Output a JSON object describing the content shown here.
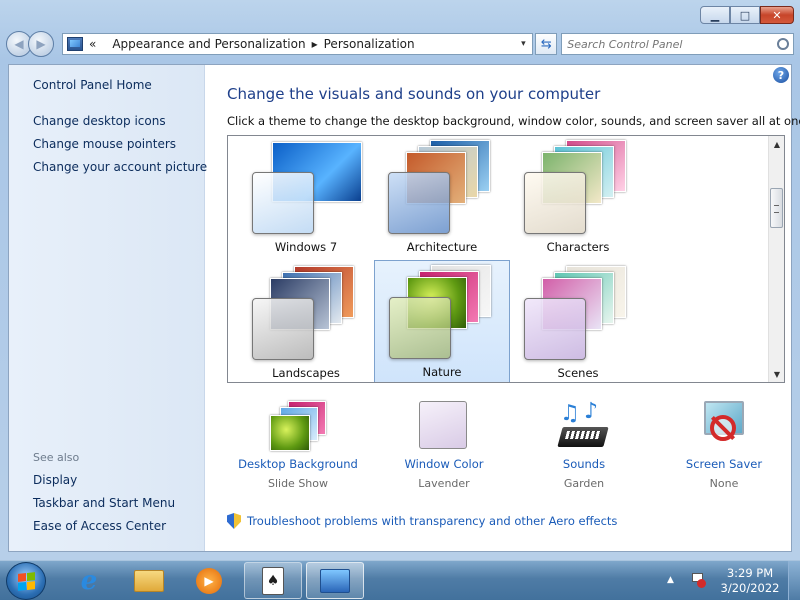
{
  "window": {
    "minimize_label": "▁",
    "maximize_label": "□",
    "close_label": "✕"
  },
  "address": {
    "overflow": "«",
    "sep": "▸",
    "crumbs": [
      "Appearance and Personalization",
      "Personalization"
    ],
    "dropdown": "▾",
    "refresh": "⇆"
  },
  "search": {
    "placeholder": "Search Control Panel"
  },
  "sidebar": {
    "home": "Control Panel Home",
    "links": [
      "Change desktop icons",
      "Change mouse pointers",
      "Change your account picture"
    ],
    "see_also": "See also",
    "see_also_links": [
      "Display",
      "Taskbar and Start Menu",
      "Ease of Access Center"
    ]
  },
  "main": {
    "help": "?",
    "title": "Change the visuals and sounds on your computer",
    "subtitle": "Click a theme to change the desktop background, window color, sounds, and screen saver all at once.",
    "themes": [
      {
        "label": "Windows 7",
        "selected": false
      },
      {
        "label": "Architecture",
        "selected": false
      },
      {
        "label": "Characters",
        "selected": false
      },
      {
        "label": "Landscapes",
        "selected": false
      },
      {
        "label": "Nature",
        "selected": true
      },
      {
        "label": "Scenes",
        "selected": false
      }
    ],
    "settings": [
      {
        "link": "Desktop Background",
        "value": "Slide Show"
      },
      {
        "link": "Window Color",
        "value": "Lavender"
      },
      {
        "link": "Sounds",
        "value": "Garden"
      },
      {
        "link": "Screen Saver",
        "value": "None"
      }
    ],
    "troubleshoot": "Troubleshoot problems with transparency and other Aero effects"
  },
  "taskbar": {
    "tray_arrow": "▲",
    "time": "3:29 PM",
    "date": "3/20/2022"
  },
  "colors": {
    "link": "#1a5bb8",
    "title": "#1e3f8a",
    "selection": "#cfe4fb"
  }
}
